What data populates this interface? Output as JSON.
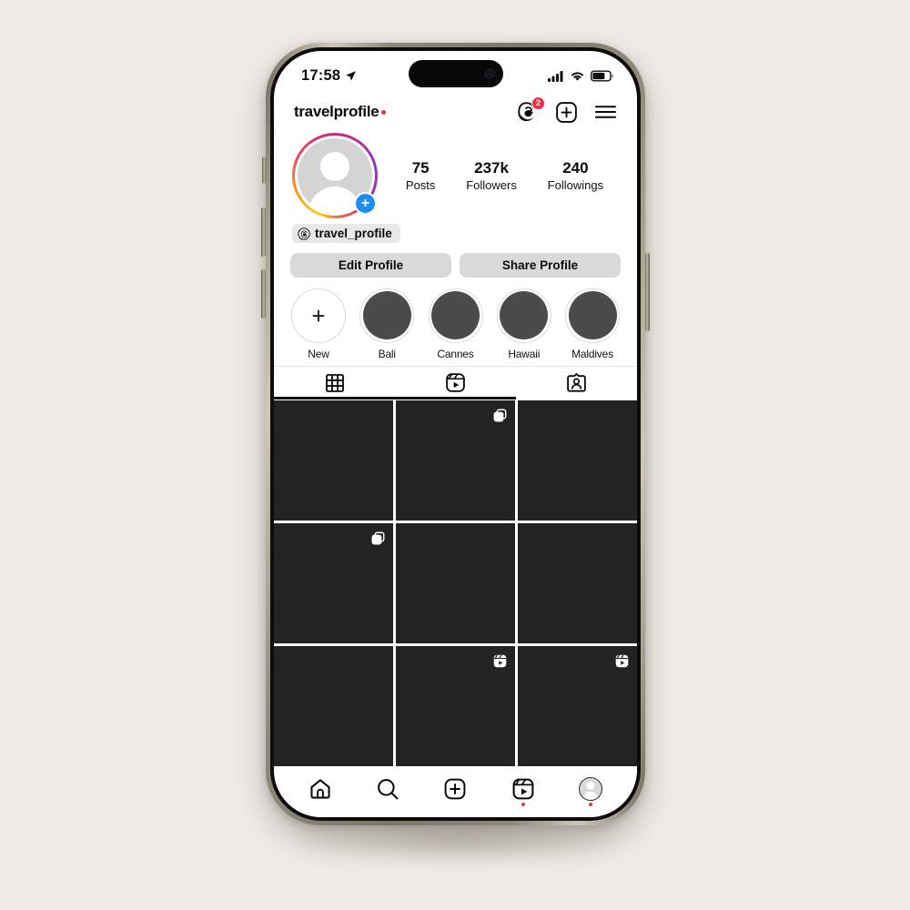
{
  "status_bar": {
    "time": "17:58",
    "location_icon": "location-arrow-icon",
    "signal_icon": "cellular-signal-icon",
    "wifi_icon": "wifi-icon",
    "battery_icon": "battery-icon",
    "battery_level_percent": 65
  },
  "header": {
    "username": "travelprofile",
    "unread_dot": true,
    "threads_icon": "threads-icon",
    "threads_badge_count": "2",
    "create_icon": "plus-circle-icon",
    "menu_icon": "hamburger-menu-icon"
  },
  "profile": {
    "avatar_icon": "default-avatar-icon",
    "has_story_ring": true,
    "add_story_label": "+",
    "stats": [
      {
        "value": "75",
        "label": "Posts"
      },
      {
        "value": "237k",
        "label": "Followers"
      },
      {
        "value": "240",
        "label": "Followings"
      }
    ],
    "threads_chip": {
      "icon": "threads-icon",
      "label": "travel_profile"
    }
  },
  "actions": {
    "edit_profile_label": "Edit Profile",
    "share_profile_label": "Share Profile"
  },
  "highlights": [
    {
      "label": "New",
      "type": "new",
      "icon": "plus-icon"
    },
    {
      "label": "Bali",
      "type": "cover"
    },
    {
      "label": "Cannes",
      "type": "cover"
    },
    {
      "label": "Hawaii",
      "type": "cover"
    },
    {
      "label": "Maldives",
      "type": "cover"
    }
  ],
  "tabs": [
    {
      "name": "grid",
      "icon": "grid-icon",
      "active": true
    },
    {
      "name": "reels",
      "icon": "reels-icon",
      "active": false
    },
    {
      "name": "tagged",
      "icon": "tagged-person-icon",
      "active": false
    }
  ],
  "posts": [
    {
      "index": 1,
      "badge": "none"
    },
    {
      "index": 2,
      "badge": "carousel-icon"
    },
    {
      "index": 3,
      "badge": "none"
    },
    {
      "index": 4,
      "badge": "carousel-icon"
    },
    {
      "index": 5,
      "badge": "none"
    },
    {
      "index": 6,
      "badge": "none"
    },
    {
      "index": 7,
      "badge": "none"
    },
    {
      "index": 8,
      "badge": "reels-icon"
    },
    {
      "index": 9,
      "badge": "reels-icon"
    }
  ],
  "bottom_nav": [
    {
      "name": "home",
      "icon": "home-icon",
      "dot": false
    },
    {
      "name": "search",
      "icon": "search-icon",
      "dot": false
    },
    {
      "name": "create",
      "icon": "plus-circle-icon",
      "dot": false
    },
    {
      "name": "reels",
      "icon": "reels-icon",
      "dot": true
    },
    {
      "name": "profile",
      "icon": "profile-avatar-icon",
      "dot": true
    }
  ],
  "colors": {
    "page_background": "#f0ebe6",
    "accent_red": "#e23a3a",
    "badge_red": "#f02b42",
    "add_story_blue": "#1b8ef2",
    "post_tile": "#232323",
    "button_gray": "#d9d9d9",
    "highlight_fill": "#4b4b4b"
  }
}
